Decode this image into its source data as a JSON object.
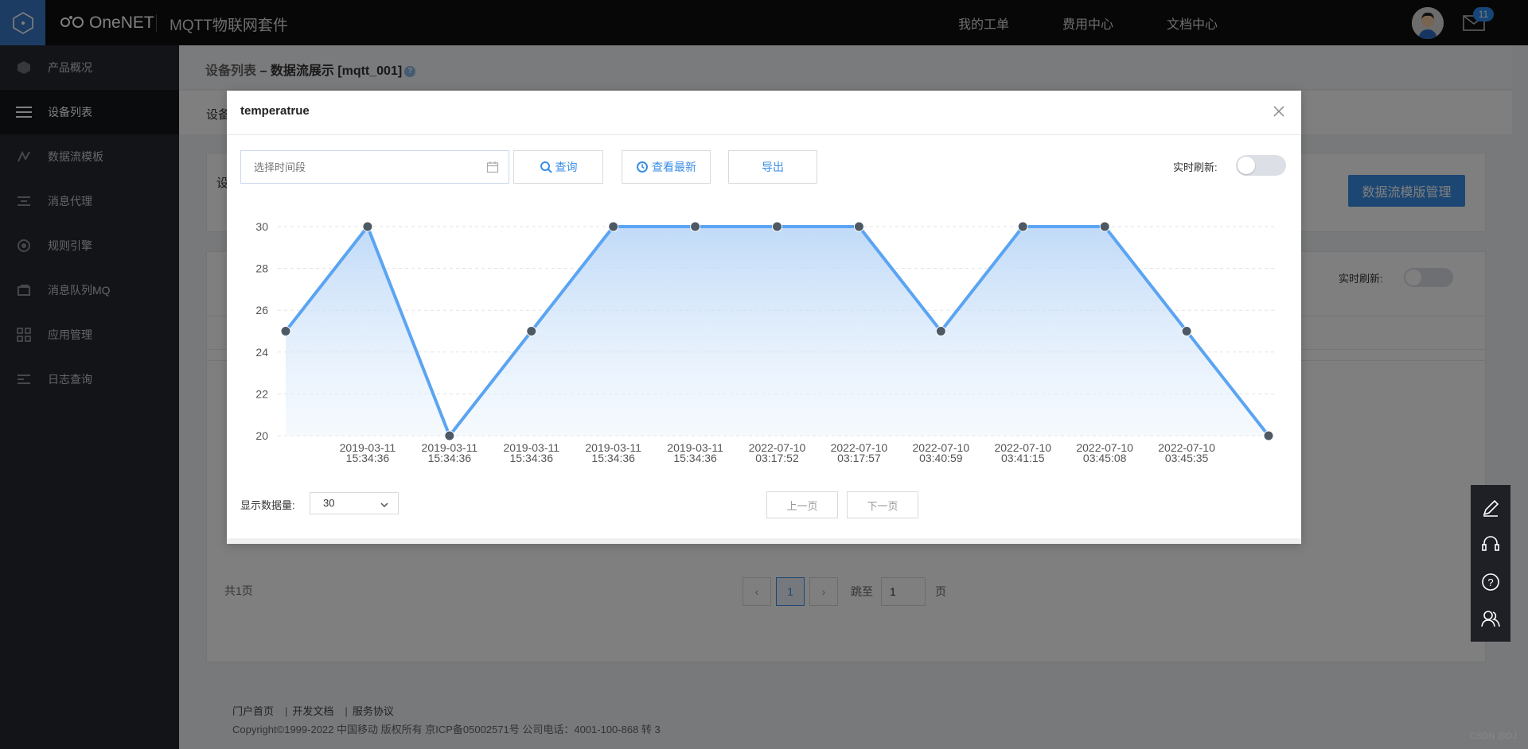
{
  "header": {
    "brand": "OneNET",
    "product": "MQTT物联网套件",
    "links": [
      "我的工单",
      "费用中心",
      "文档中心"
    ],
    "mail_badge": "11"
  },
  "sidebar": {
    "items": [
      {
        "label": "产品概况",
        "icon": "cube-icon"
      },
      {
        "label": "设备列表",
        "icon": "list-icon",
        "active": true
      },
      {
        "label": "数据流模板",
        "icon": "stream-icon"
      },
      {
        "label": "消息代理",
        "icon": "proxy-icon"
      },
      {
        "label": "规则引擎",
        "icon": "rule-icon"
      },
      {
        "label": "消息队列MQ",
        "icon": "queue-icon"
      },
      {
        "label": "应用管理",
        "icon": "grid-icon"
      },
      {
        "label": "日志查询",
        "icon": "log-icon"
      }
    ]
  },
  "main": {
    "breadcrumb": {
      "parent": "设备列表",
      "sep": " – ",
      "current": "数据流展示 [mqtt_001]",
      "help": "?"
    },
    "tab_label": "设备",
    "card_label": "设",
    "template_button": "数据流模版管理",
    "realtime_label": "实时刷新:",
    "total_pages": "共1页",
    "pager": {
      "prev": "‹",
      "current": "1",
      "next": "›",
      "jump_label": "跳至",
      "jump_value": "1",
      "unit": "页"
    }
  },
  "footer": {
    "links": [
      "门户首页",
      "开发文档",
      "服务协议"
    ],
    "copyright": "Copyright©1999-2022 中国移动 版权所有 京ICP备05002571号 公司电话：4001-100-868 转 3"
  },
  "watermark": "CSDN @DJ",
  "modal": {
    "title": "temperatrue",
    "date_placeholder": "选择时间段",
    "query_button": "查询",
    "latest_button": "查看最新",
    "export_button": "导出",
    "realtime_label": "实时刷新:",
    "count_label": "显示数据量:",
    "count_value": "30",
    "prev_button": "上一页",
    "next_button": "下一页"
  },
  "colors": {
    "accent": "#3a8ee6",
    "line": "#5ba4f2",
    "point": "#4d5a66",
    "topbar": "#0f0f10",
    "sidebar": "#252830"
  },
  "chart_data": {
    "type": "area",
    "x": [
      "",
      "2019-03-11 15:34:36",
      "2019-03-11 15:34:36",
      "2019-03-11 15:34:36",
      "2019-03-11 15:34:36",
      "2019-03-11 15:34:36",
      "2022-07-10 03:17:52",
      "2022-07-10 03:17:57",
      "2022-07-10 03:40:59",
      "2022-07-10 03:41:15",
      "2022-07-10 03:45:08",
      "2022-07-10 03:45:35",
      ""
    ],
    "values": [
      25,
      30,
      20,
      25,
      30,
      30,
      30,
      30,
      25,
      30,
      30,
      25,
      20
    ],
    "yticks": [
      20,
      22,
      24,
      26,
      28,
      30
    ],
    "ylim": [
      20,
      30
    ],
    "grid": true
  }
}
